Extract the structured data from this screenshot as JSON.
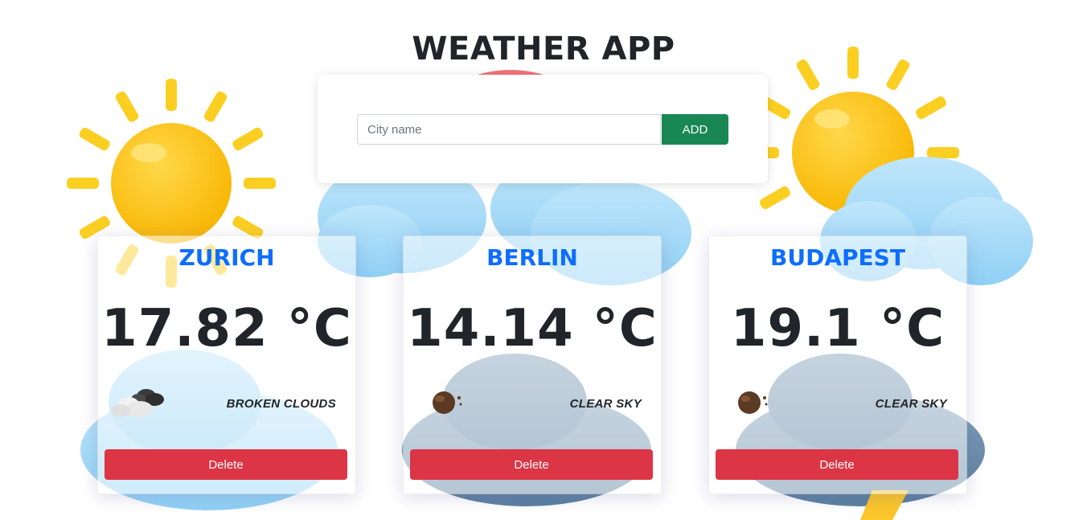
{
  "app": {
    "title": "WEATHER APP"
  },
  "search": {
    "placeholder": "City name",
    "value": "",
    "add_label": "ADD"
  },
  "cities": [
    {
      "name": "ZURICH",
      "temperature": "17.82 °C",
      "description": "BROKEN CLOUDS",
      "icon": "broken-clouds-icon",
      "delete_label": "Delete"
    },
    {
      "name": "BERLIN",
      "temperature": "14.14 °C",
      "description": "CLEAR SKY",
      "icon": "clear-sky-night-icon",
      "delete_label": "Delete"
    },
    {
      "name": "BUDAPEST",
      "temperature": "19.1 °C",
      "description": "CLEAR SKY",
      "icon": "clear-sky-night-icon",
      "delete_label": "Delete"
    }
  ],
  "colors": {
    "title": "#212529",
    "city_name": "#0d6efd",
    "add_button": "#198754",
    "delete_button": "#dc3545"
  }
}
